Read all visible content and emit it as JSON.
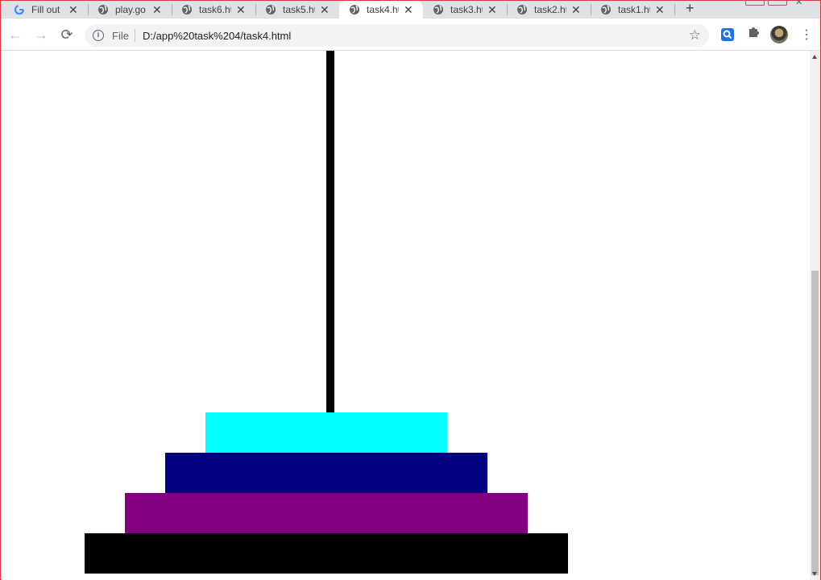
{
  "browser": {
    "tabs": [
      {
        "title": "Fill out",
        "icon": "google-icon",
        "active": false
      },
      {
        "title": "play.go",
        "icon": "globe-icon",
        "active": false
      },
      {
        "title": "task6.ht",
        "icon": "globe-icon",
        "active": false
      },
      {
        "title": "task5.ht",
        "icon": "globe-icon",
        "active": false
      },
      {
        "title": "task4.ht",
        "icon": "globe-icon",
        "active": true
      },
      {
        "title": "task3.ht",
        "icon": "globe-icon",
        "active": false
      },
      {
        "title": "task2.ht",
        "icon": "globe-icon",
        "active": false
      },
      {
        "title": "task1.ht",
        "icon": "globe-icon",
        "active": false
      }
    ],
    "close_glyph": "✕",
    "new_tab_glyph": "+",
    "address": {
      "scheme_label": "File",
      "url": "D:/app%20task%204/task4.html"
    },
    "nav": {
      "back_glyph": "←",
      "forward_glyph": "→",
      "reload_glyph": "⟳"
    }
  },
  "page": {
    "peg_color": "#000000",
    "disks": [
      {
        "name": "disk-1",
        "color": "#00ffff",
        "size_rank": 1
      },
      {
        "name": "disk-2",
        "color": "#000080",
        "size_rank": 2
      },
      {
        "name": "disk-3",
        "color": "#800080",
        "size_rank": 3
      },
      {
        "name": "disk-4",
        "color": "#000000",
        "size_rank": 4
      }
    ]
  }
}
